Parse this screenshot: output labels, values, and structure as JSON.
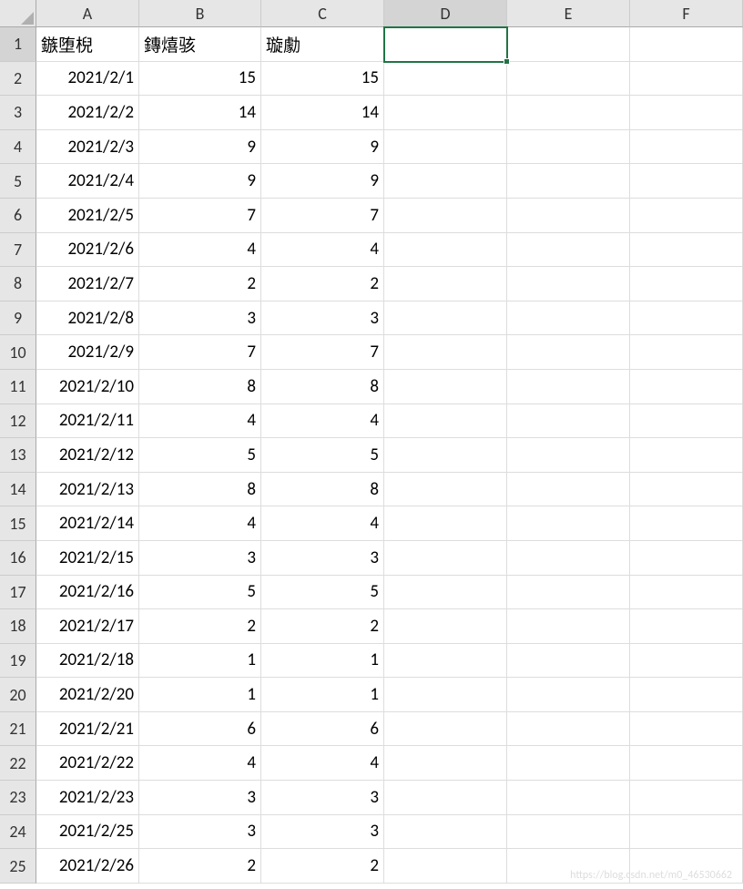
{
  "columns": [
    "A",
    "B",
    "C",
    "D",
    "E",
    "F"
  ],
  "rowCount": 25,
  "activeCell": {
    "row": 1,
    "col": "D"
  },
  "headers": {
    "A": "鏃堕棿",
    "B": "鏄熺骇",
    "C": "璇勮"
  },
  "rows": [
    {
      "r": 2,
      "A": "2021/2/1",
      "B": "15",
      "C": "15"
    },
    {
      "r": 3,
      "A": "2021/2/2",
      "B": "14",
      "C": "14"
    },
    {
      "r": 4,
      "A": "2021/2/3",
      "B": "9",
      "C": "9"
    },
    {
      "r": 5,
      "A": "2021/2/4",
      "B": "9",
      "C": "9"
    },
    {
      "r": 6,
      "A": "2021/2/5",
      "B": "7",
      "C": "7"
    },
    {
      "r": 7,
      "A": "2021/2/6",
      "B": "4",
      "C": "4"
    },
    {
      "r": 8,
      "A": "2021/2/7",
      "B": "2",
      "C": "2"
    },
    {
      "r": 9,
      "A": "2021/2/8",
      "B": "3",
      "C": "3"
    },
    {
      "r": 10,
      "A": "2021/2/9",
      "B": "7",
      "C": "7"
    },
    {
      "r": 11,
      "A": "2021/2/10",
      "B": "8",
      "C": "8"
    },
    {
      "r": 12,
      "A": "2021/2/11",
      "B": "4",
      "C": "4"
    },
    {
      "r": 13,
      "A": "2021/2/12",
      "B": "5",
      "C": "5"
    },
    {
      "r": 14,
      "A": "2021/2/13",
      "B": "8",
      "C": "8"
    },
    {
      "r": 15,
      "A": "2021/2/14",
      "B": "4",
      "C": "4"
    },
    {
      "r": 16,
      "A": "2021/2/15",
      "B": "3",
      "C": "3"
    },
    {
      "r": 17,
      "A": "2021/2/16",
      "B": "5",
      "C": "5"
    },
    {
      "r": 18,
      "A": "2021/2/17",
      "B": "2",
      "C": "2"
    },
    {
      "r": 19,
      "A": "2021/2/18",
      "B": "1",
      "C": "1"
    },
    {
      "r": 20,
      "A": "2021/2/20",
      "B": "1",
      "C": "1"
    },
    {
      "r": 21,
      "A": "2021/2/21",
      "B": "6",
      "C": "6"
    },
    {
      "r": 22,
      "A": "2021/2/22",
      "B": "4",
      "C": "4"
    },
    {
      "r": 23,
      "A": "2021/2/23",
      "B": "3",
      "C": "3"
    },
    {
      "r": 24,
      "A": "2021/2/25",
      "B": "3",
      "C": "3"
    },
    {
      "r": 25,
      "A": "2021/2/26",
      "B": "2",
      "C": "2"
    }
  ],
  "watermark": "https://blog.csdn.net/m0_46530662"
}
